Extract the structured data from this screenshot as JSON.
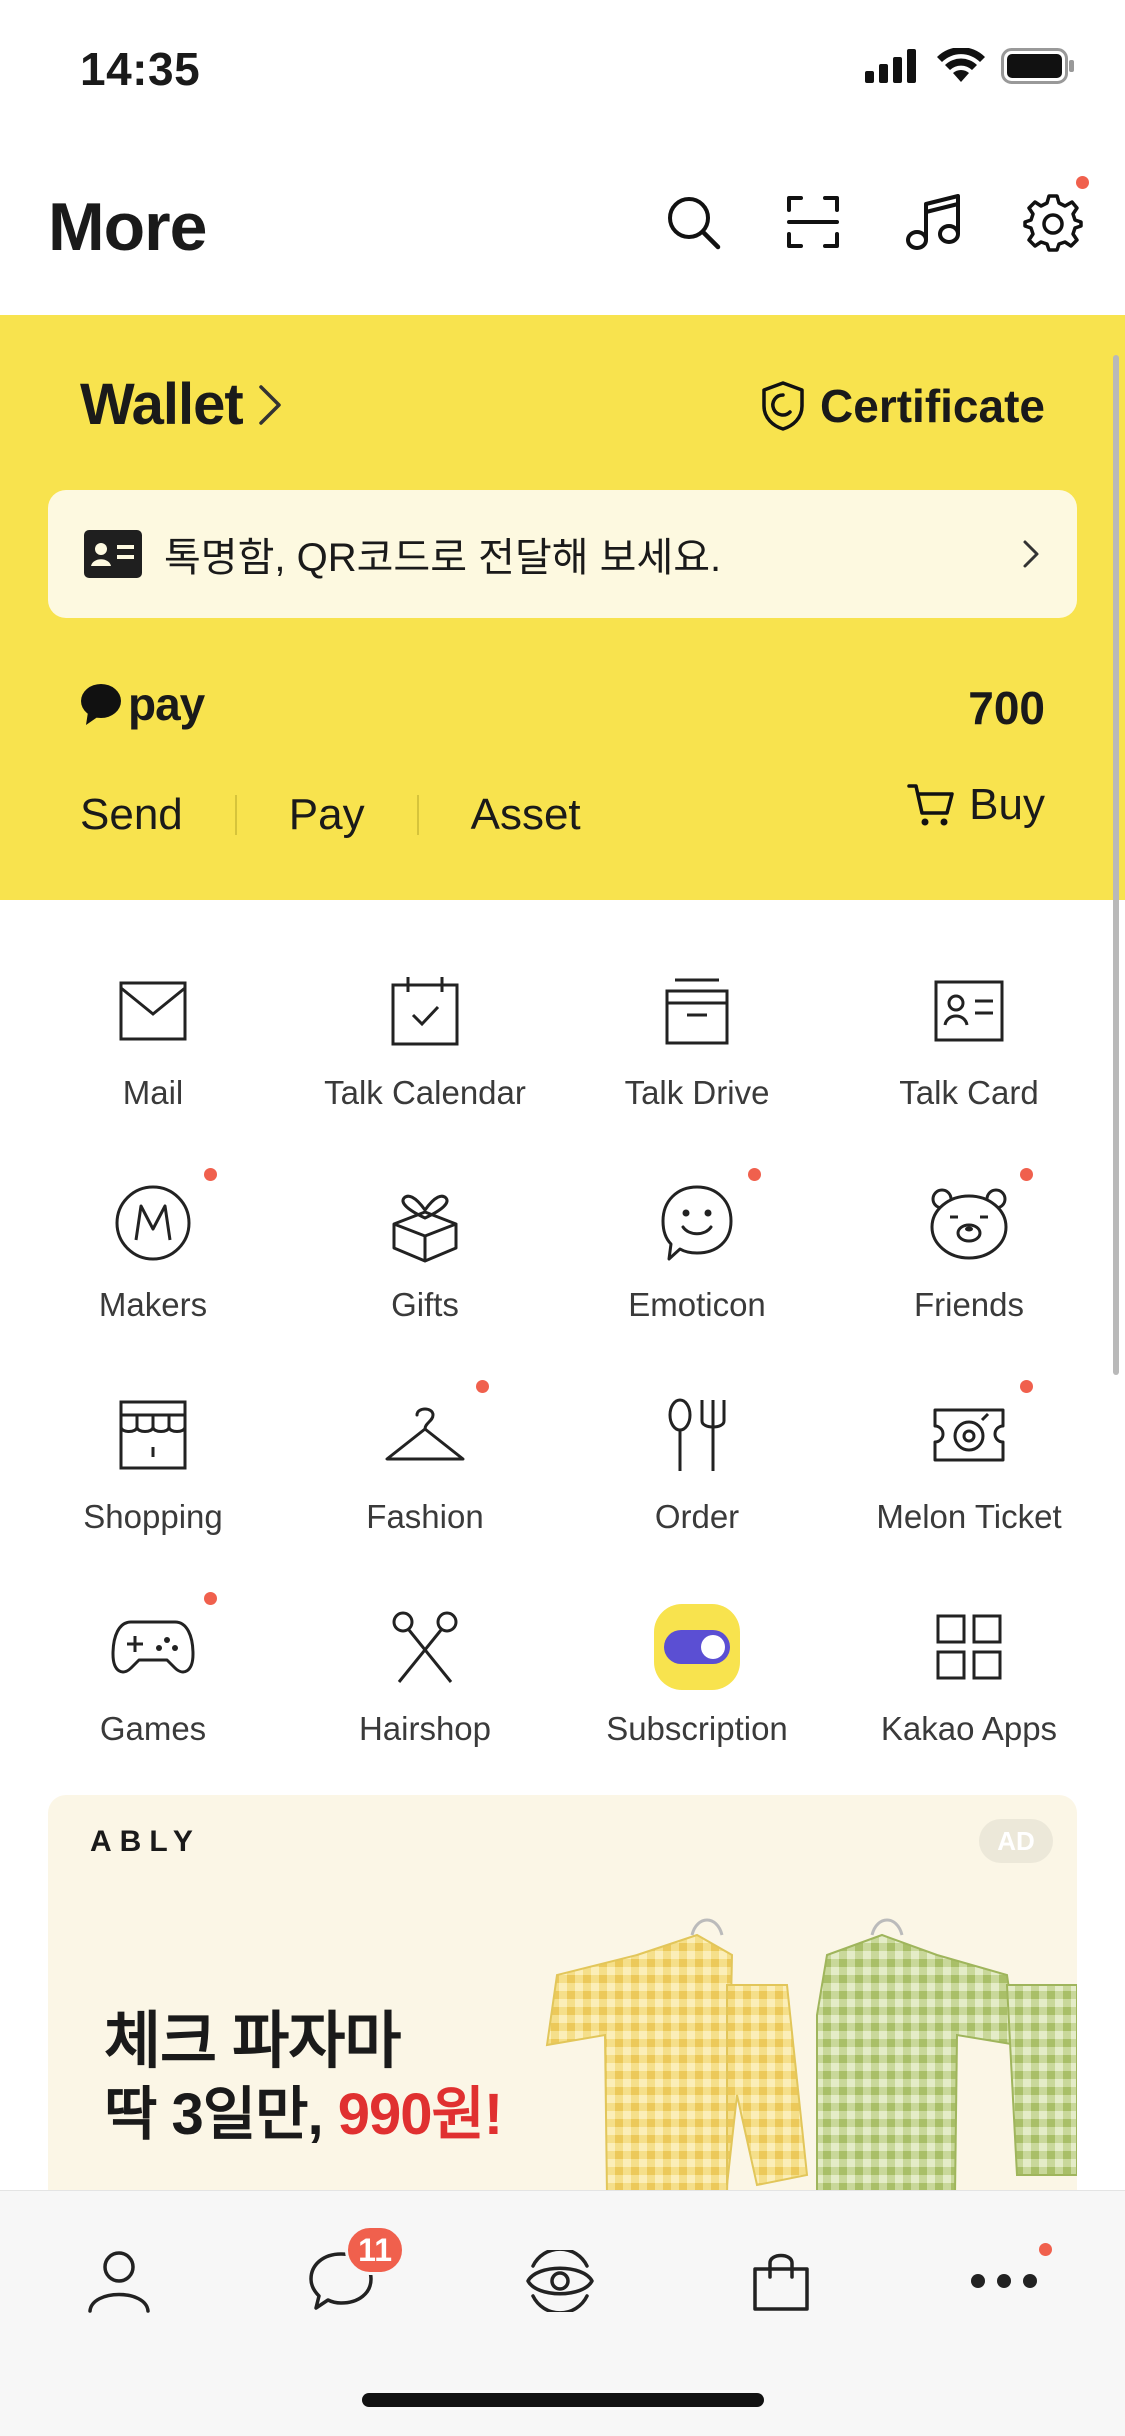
{
  "status": {
    "time": "14:35"
  },
  "header": {
    "title": "More"
  },
  "wallet": {
    "title": "Wallet",
    "certificate_label": "Certificate",
    "notice": "톡명함, QR코드로 전달해 보세요.",
    "pay_logo": "pay",
    "pay_amount": "700",
    "actions": [
      "Send",
      "Pay",
      "Asset"
    ],
    "buy_label": "Buy"
  },
  "grid": {
    "items": [
      {
        "label": "Mail",
        "icon": "mail-icon",
        "dot": false
      },
      {
        "label": "Talk Calendar",
        "icon": "calendar-icon",
        "dot": false
      },
      {
        "label": "Talk Drive",
        "icon": "drive-icon",
        "dot": false
      },
      {
        "label": "Talk Card",
        "icon": "card-icon",
        "dot": false
      },
      {
        "label": "Makers",
        "icon": "makers-icon",
        "dot": true
      },
      {
        "label": "Gifts",
        "icon": "gift-icon",
        "dot": false
      },
      {
        "label": "Emoticon",
        "icon": "emoticon-icon",
        "dot": true
      },
      {
        "label": "Friends",
        "icon": "friends-icon",
        "dot": true
      },
      {
        "label": "Shopping",
        "icon": "shopping-icon",
        "dot": false
      },
      {
        "label": "Fashion",
        "icon": "hanger-icon",
        "dot": true
      },
      {
        "label": "Order",
        "icon": "fork-spoon-icon",
        "dot": false
      },
      {
        "label": "Melon Ticket",
        "icon": "ticket-icon",
        "dot": true
      },
      {
        "label": "Games",
        "icon": "gamepad-icon",
        "dot": true
      },
      {
        "label": "Hairshop",
        "icon": "scissors-icon",
        "dot": false
      },
      {
        "label": "Subscription",
        "icon": "toggle-icon",
        "dot": false
      },
      {
        "label": "Kakao Apps",
        "icon": "apps-grid-icon",
        "dot": false
      }
    ]
  },
  "ad": {
    "brand": "ABLY",
    "badge": "AD",
    "line1": "체크 파자마",
    "line2_prefix": "딱 3일만, ",
    "line2_price": "990원!"
  },
  "tabbar": {
    "chat_badge": "11"
  },
  "colors": {
    "wallet_bg": "#f8e34e",
    "dot": "#f0604d",
    "subscription_accent": "#5b4fd3"
  }
}
